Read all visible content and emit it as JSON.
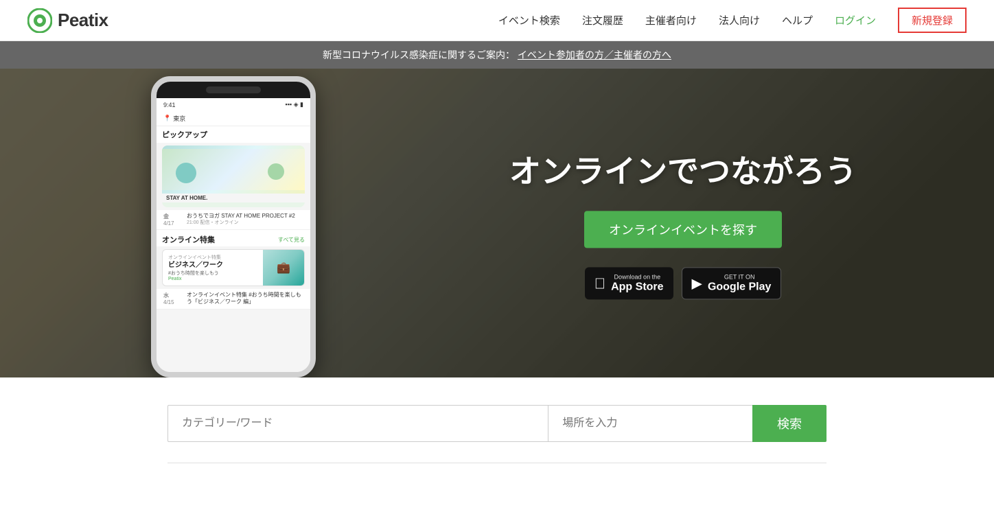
{
  "header": {
    "logo_text": "Peatix",
    "nav_items": [
      {
        "label": "イベント検索",
        "id": "event-search"
      },
      {
        "label": "注文履歴",
        "id": "order-history"
      },
      {
        "label": "主催者向け",
        "id": "for-organizers"
      },
      {
        "label": "法人向け",
        "id": "for-business"
      },
      {
        "label": "ヘルプ",
        "id": "help"
      },
      {
        "label": "ログイン",
        "id": "login",
        "highlight": true
      },
      {
        "label": "新規登録",
        "id": "register"
      }
    ]
  },
  "announcement": {
    "text": "新型コロナウイルス感染症に関するご案内：",
    "link_text": "イベント参加者の方／主催者の方へ"
  },
  "hero": {
    "title": "オンラインでつながろう",
    "cta_label": "オンラインイベントを探す",
    "app_store": {
      "top_label": "Download on the",
      "main_label": "App Store"
    },
    "google_play": {
      "top_label": "GET IT ON",
      "main_label": "Google Play"
    }
  },
  "phone": {
    "time": "9:41",
    "location": "東京",
    "pickup_label": "ピックアップ",
    "stay_at_home": "STAY AT HOME.",
    "event1_date": "金\n4/17",
    "event1_title": "おうちでヨガ STAY AT HOME PROJECT #2",
    "event1_time": "21:00 配信・オンライン",
    "online_label": "オンライン特集",
    "all_see": "すべて見る",
    "online_card_label": "オンラインイベント特集",
    "online_card_title": "ビジネス／ワーク",
    "online_card_tag": "#おうち時間を楽しもう",
    "online_brand": "Peatix",
    "event2_date": "水\n4/15",
    "event2_title": "オンラインイベント特集 #おうち時間を楽しもう「ビジネス／ワーク 編」"
  },
  "search": {
    "category_placeholder": "カテゴリー/ワード",
    "location_placeholder": "場所を入力",
    "button_label": "検索"
  }
}
